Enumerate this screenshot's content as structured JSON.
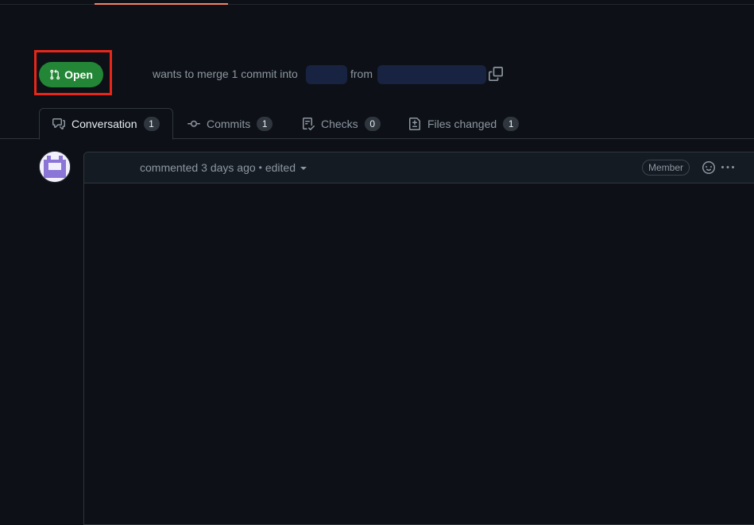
{
  "pr_state": {
    "label": "Open",
    "icon": "git-pull-request-icon",
    "color": "#238636"
  },
  "merge_summary": {
    "prefix": "wants to merge 1 commit into",
    "joiner": "from",
    "copy_icon": "copy-icon"
  },
  "tabs": [
    {
      "label": "Conversation",
      "count": "1",
      "icon": "comment-discussion-icon",
      "active": true
    },
    {
      "label": "Commits",
      "count": "1",
      "icon": "git-commit-icon",
      "active": false
    },
    {
      "label": "Checks",
      "count": "0",
      "icon": "checklist-icon",
      "active": false
    },
    {
      "label": "Files changed",
      "count": "1",
      "icon": "file-diff-icon",
      "active": false
    }
  ],
  "comment": {
    "action": "commented",
    "time": "3 days ago",
    "separator": "•",
    "edited_label": "edited",
    "role_badge": "Member",
    "reaction_icon": "smiley-icon",
    "more_icon": "kebab-horizontal-icon"
  },
  "colors": {
    "accent_underline": "#f78166",
    "highlight_box": "#e8261a",
    "background": "#0d1117"
  }
}
